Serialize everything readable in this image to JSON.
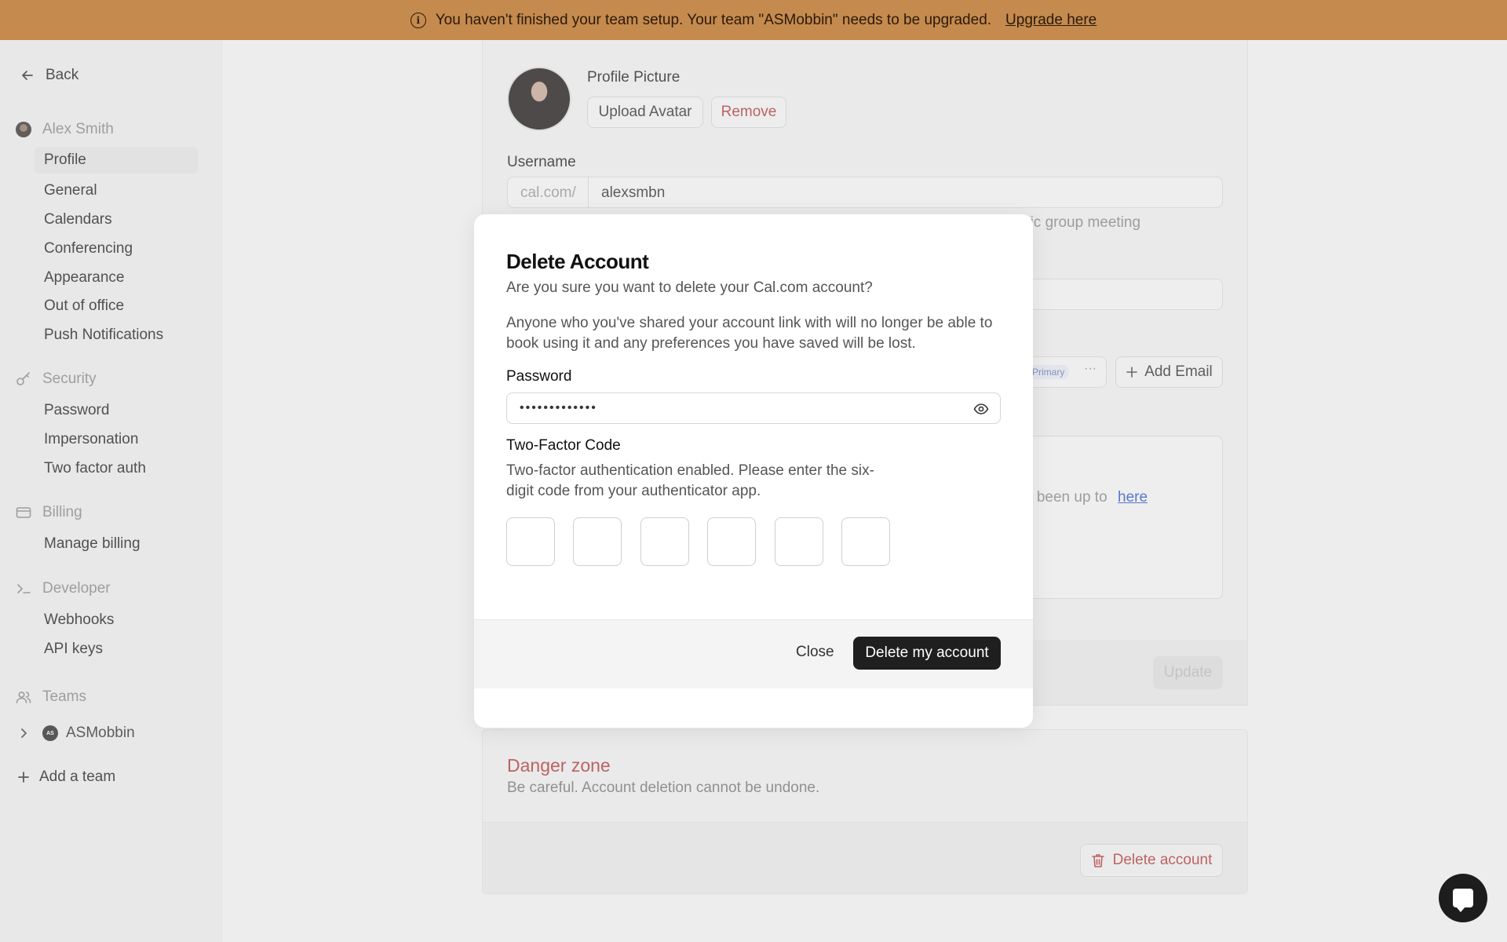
{
  "banner": {
    "message": "You haven't finished your team setup. Your team \"ASMobbin\" needs to be upgraded.",
    "link": "Upgrade here"
  },
  "sidebar": {
    "back": "Back",
    "user_name": "Alex Smith",
    "profile_items": [
      "Profile",
      "General",
      "Calendars",
      "Conferencing",
      "Appearance",
      "Out of office",
      "Push Notifications"
    ],
    "security_head": "Security",
    "security_items": [
      "Password",
      "Impersonation",
      "Two factor auth"
    ],
    "billing_head": "Billing",
    "billing_items": [
      "Manage billing"
    ],
    "developer_head": "Developer",
    "developer_items": [
      "Webhooks",
      "API keys"
    ],
    "teams_head": "Teams",
    "team_name": "ASMobbin",
    "team_initials": "AS",
    "add_team": "Add a team"
  },
  "profile": {
    "picture_label": "Profile Picture",
    "upload_button": "Upload Avatar",
    "remove_button": "Remove",
    "username_label": "Username",
    "username_prefix": "cal.com/",
    "username_value": "alexsmbn",
    "username_hint_fragment": "nic group meeting",
    "email_badge": "Primary",
    "add_email": "Add Email",
    "about_fragment": "e been up to",
    "about_link": "here",
    "update_button": "Update"
  },
  "danger": {
    "title": "Danger zone",
    "subtitle": "Be careful. Account deletion cannot be undone.",
    "delete_button": "Delete account"
  },
  "modal": {
    "title": "Delete Account",
    "subtitle": "Are you sure you want to delete your Cal.com account?",
    "description": "Anyone who you've shared your account link with will no longer be able to book using it and any preferences you have saved will be lost.",
    "password_label": "Password",
    "password_value": "•••••••••••••",
    "twofa_label": "Two-Factor Code",
    "twofa_desc": "Two-factor authentication enabled. Please enter the six-digit code from your authenticator app.",
    "close_button": "Close",
    "delete_button": "Delete my account"
  }
}
